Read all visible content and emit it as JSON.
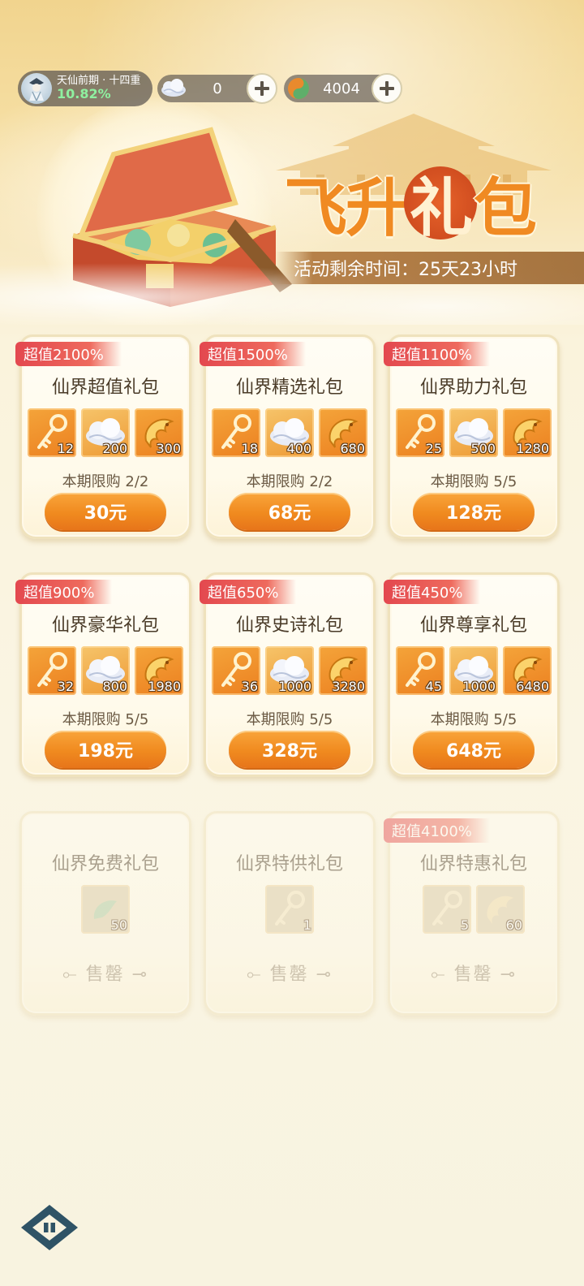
{
  "header": {
    "player": {
      "realm": "天仙前期 · 十四重",
      "progress": "10.82%"
    },
    "resources": [
      {
        "icon": "cloud-currency-icon",
        "value": "0"
      },
      {
        "icon": "jade-currency-icon",
        "value": "4004"
      }
    ]
  },
  "banner": {
    "title": [
      "飞",
      "升",
      "礼",
      "包"
    ],
    "timer": "活动剩余时间：25天23小时"
  },
  "packs": [
    {
      "badge": "超值2100%",
      "name": "仙界超值礼包",
      "items": [
        "12",
        "200",
        "300"
      ],
      "limit": "本期限购 2/2",
      "price": "30元"
    },
    {
      "badge": "超值1500%",
      "name": "仙界精选礼包",
      "items": [
        "18",
        "400",
        "680"
      ],
      "limit": "本期限购 2/2",
      "price": "68元"
    },
    {
      "badge": "超值1100%",
      "name": "仙界助力礼包",
      "items": [
        "25",
        "500",
        "1280"
      ],
      "limit": "本期限购 5/5",
      "price": "128元"
    },
    {
      "badge": "超值900%",
      "name": "仙界豪华礼包",
      "items": [
        "32",
        "800",
        "1980"
      ],
      "limit": "本期限购 5/5",
      "price": "198元"
    },
    {
      "badge": "超值650%",
      "name": "仙界史诗礼包",
      "items": [
        "36",
        "1000",
        "3280"
      ],
      "limit": "本期限购 5/5",
      "price": "328元"
    },
    {
      "badge": "超值450%",
      "name": "仙界尊享礼包",
      "items": [
        "45",
        "1000",
        "6480"
      ],
      "limit": "本期限购 5/5",
      "price": "648元"
    }
  ],
  "soldout_packs": [
    {
      "name": "仙界免费礼包",
      "items": [
        "50"
      ],
      "status": "售罄"
    },
    {
      "name": "仙界特供礼包",
      "items": [
        "1"
      ],
      "status": "售罄"
    },
    {
      "badge": "超值4100%",
      "name": "仙界特惠礼包",
      "items": [
        "5",
        "60"
      ],
      "status": "售罄"
    }
  ],
  "item_icons": [
    "golden-key-icon",
    "cloud-icon",
    "dragon-jade-icon"
  ],
  "colors": {
    "accent": "#f08a1f",
    "badge": "#e3484f",
    "title": "#f08a22"
  }
}
